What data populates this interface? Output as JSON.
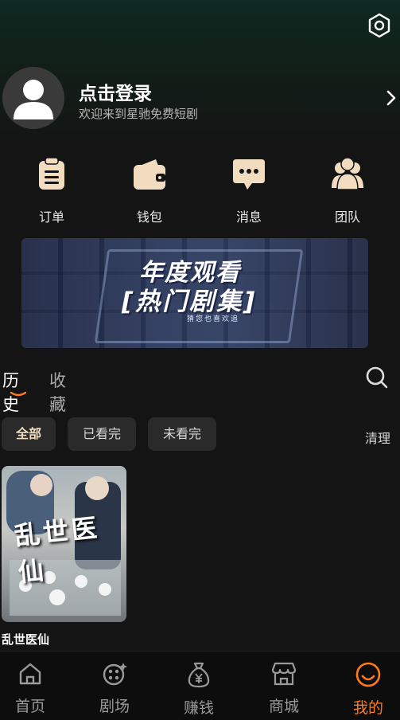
{
  "profile": {
    "title": "点击登录",
    "subtitle": "欢迎来到星驰免费短剧"
  },
  "quick_actions": [
    {
      "label": "订单",
      "icon": "clipboard-icon"
    },
    {
      "label": "钱包",
      "icon": "wallet-icon"
    },
    {
      "label": "消息",
      "icon": "message-icon"
    },
    {
      "label": "团队",
      "icon": "team-icon"
    }
  ],
  "banner": {
    "line1": "年度观看",
    "line2": "[热门剧集]",
    "line3": "猜您也喜欢追"
  },
  "history": {
    "tab_history": "历史",
    "tab_favorites": "收藏"
  },
  "filters": {
    "all": "全部",
    "watched": "已看完",
    "unwatched": "未看完",
    "clear": "清理"
  },
  "cards": [
    {
      "title": "乱世医仙",
      "poster_text": "乱世医仙"
    }
  ],
  "bottom_nav": [
    {
      "label": "首页",
      "icon": "home-icon"
    },
    {
      "label": "剧场",
      "icon": "theater-icon"
    },
    {
      "label": "赚钱",
      "icon": "money-bag-icon"
    },
    {
      "label": "商城",
      "icon": "store-icon"
    },
    {
      "label": "我的",
      "icon": "smile-icon",
      "active": true
    }
  ],
  "colors": {
    "accent": "#ff7a1a",
    "icon_beige": "#f2dcc0",
    "background": "#141414"
  }
}
